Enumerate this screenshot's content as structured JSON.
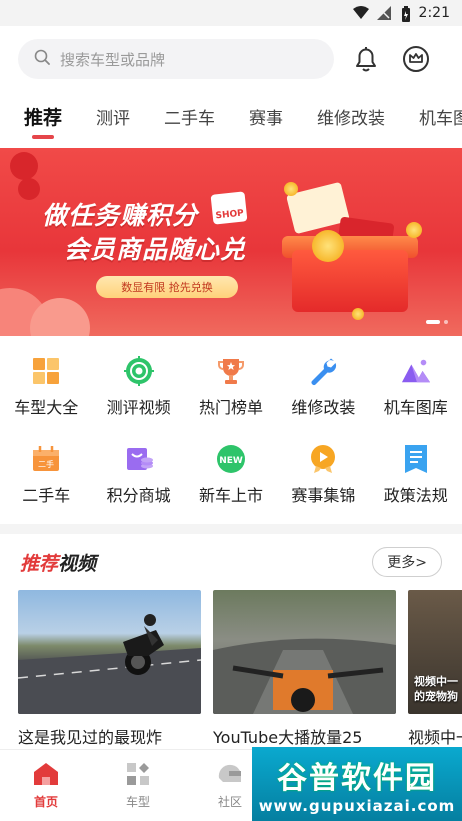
{
  "status": {
    "time": "2:21"
  },
  "search": {
    "placeholder": "搜索车型或品牌"
  },
  "tabs": [
    {
      "label": "推荐",
      "active": true
    },
    {
      "label": "测评"
    },
    {
      "label": "二手车"
    },
    {
      "label": "赛事"
    },
    {
      "label": "维修改装"
    },
    {
      "label": "机车图"
    }
  ],
  "banner": {
    "title_line1": "做任务赚积分",
    "title_line2": "会员商品随心兑",
    "shop_tag": "SHOP",
    "pill_text": "数显有限 抢先兑换"
  },
  "grid": [
    {
      "label": "车型大全",
      "icon": "car-models-icon",
      "color": "#f7a23b"
    },
    {
      "label": "测评视频",
      "icon": "review-video-icon",
      "color": "#2ec46a"
    },
    {
      "label": "热门榜单",
      "icon": "trophy-icon",
      "color": "#f07a4a"
    },
    {
      "label": "维修改装",
      "icon": "wrench-icon",
      "color": "#3a8ff0"
    },
    {
      "label": "机车图库",
      "icon": "gallery-icon",
      "color": "#8a5cf0"
    },
    {
      "label": "二手车",
      "icon": "used-car-icon",
      "color": "#f7943b"
    },
    {
      "label": "积分商城",
      "icon": "points-mall-icon",
      "color": "#9a6cf0"
    },
    {
      "label": "新车上市",
      "icon": "new-badge-icon",
      "color": "#2ec46a"
    },
    {
      "label": "赛事集锦",
      "icon": "race-highlights-icon",
      "color": "#f7a623"
    },
    {
      "label": "政策法规",
      "icon": "policy-doc-icon",
      "color": "#3aa3f0"
    }
  ],
  "recommend": {
    "title_prefix": "推荐",
    "title_suffix": "视频",
    "more_label": "更多>"
  },
  "videos": [
    {
      "title": "这是我见过的最现炸"
    },
    {
      "title": "YouTube大播放量25"
    },
    {
      "title": "视频中一的宠物狗来"
    }
  ],
  "video3_overlay": {
    "line1": "视频中一",
    "line2": "的宠物狗"
  },
  "bottom_nav": [
    {
      "label": "首页",
      "icon": "home-icon",
      "active": true
    },
    {
      "label": "车型",
      "icon": "car-grid-icon"
    },
    {
      "label": "社区",
      "icon": "helmet-icon"
    }
  ],
  "watermark": {
    "name": "谷普软件园",
    "url": "www.gupuxiazai.com"
  },
  "colors": {
    "accent": "#e23b3b",
    "banner": "#ec3e3e"
  }
}
